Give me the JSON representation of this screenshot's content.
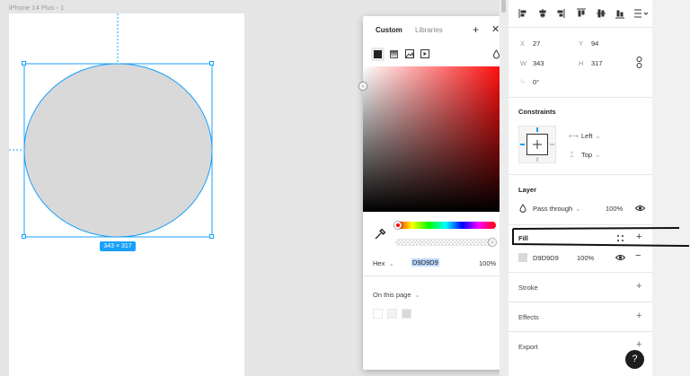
{
  "canvas": {
    "frame_label": "iPhone 14 Plus - 1",
    "size_badge": "343 × 317",
    "ellipse_fill": "#D9D9D9",
    "selection_color": "#18A0FB"
  },
  "props": {
    "x_label": "X",
    "x_value": "27",
    "y_label": "Y",
    "y_value": "94",
    "w_label": "W",
    "w_value": "343",
    "h_label": "H",
    "h_value": "317",
    "rotation": "0°",
    "constraints_title": "Constraints",
    "constraint_h": "Left",
    "constraint_v": "Top",
    "layer_title": "Layer",
    "blend_mode": "Pass through",
    "layer_opacity": "100%",
    "fill_title": "Fill",
    "fill_hex": "D9D9D9",
    "fill_opacity": "100%",
    "stroke_title": "Stroke",
    "effects_title": "Effects",
    "export_title": "Export"
  },
  "picker": {
    "tab_custom": "Custom",
    "tab_libraries": "Libraries",
    "format": "Hex",
    "hex_value": "D9D9D9",
    "opacity": "100%",
    "on_this_page": "On this page",
    "swatch_colors": [
      "#FFFFFF",
      "#F2F2F2",
      "#D9D9D9"
    ]
  },
  "help_label": "?"
}
